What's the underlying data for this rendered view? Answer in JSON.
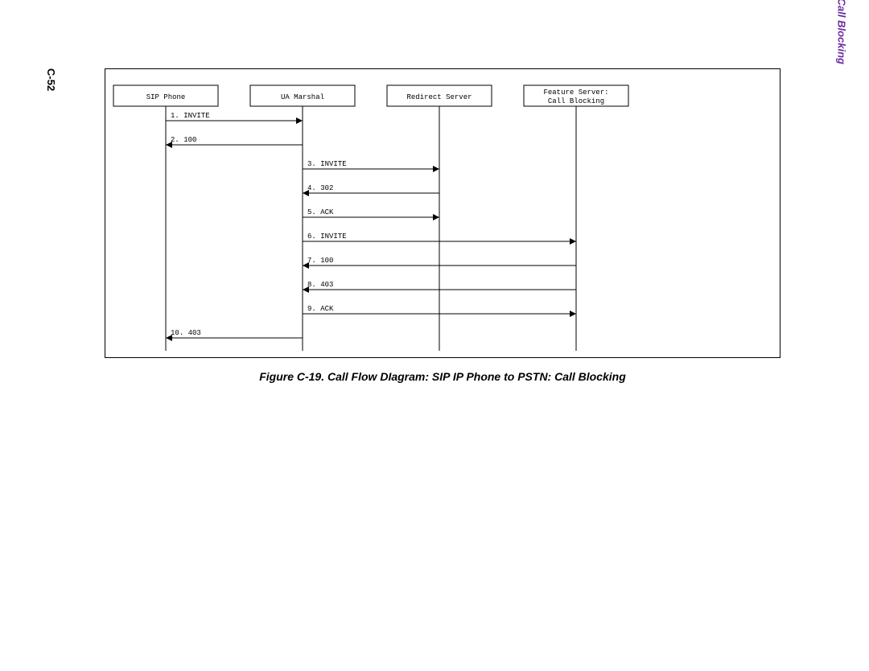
{
  "pageNumber": "C-52",
  "sideTitle": "SIP Phone to PSTN: Call Blocking",
  "caption": "Figure C-19. Call Flow DIagram: SIP IP Phone to PSTN: Call Blocking",
  "actors": [
    {
      "id": "a0",
      "label": "SIP Phone",
      "lines": 1
    },
    {
      "id": "a1",
      "label": "UA Marshal",
      "lines": 1
    },
    {
      "id": "a2",
      "label": "Redirect Server",
      "lines": 1
    },
    {
      "id": "a3",
      "label": "Feature Server:\nCall Blocking",
      "lines": 2
    }
  ],
  "messages": [
    {
      "from": 0,
      "to": 1,
      "label": "1. INVITE"
    },
    {
      "from": 1,
      "to": 0,
      "label": "2. 100"
    },
    {
      "from": 1,
      "to": 2,
      "label": "3. INVITE"
    },
    {
      "from": 2,
      "to": 1,
      "label": "4. 302"
    },
    {
      "from": 1,
      "to": 2,
      "label": "5. ACK"
    },
    {
      "from": 1,
      "to": 3,
      "label": "6. INVITE"
    },
    {
      "from": 3,
      "to": 1,
      "label": "7. 100"
    },
    {
      "from": 3,
      "to": 1,
      "label": "8. 403"
    },
    {
      "from": 1,
      "to": 3,
      "label": "9. ACK"
    },
    {
      "from": 1,
      "to": 0,
      "label": "10. 403"
    }
  ]
}
